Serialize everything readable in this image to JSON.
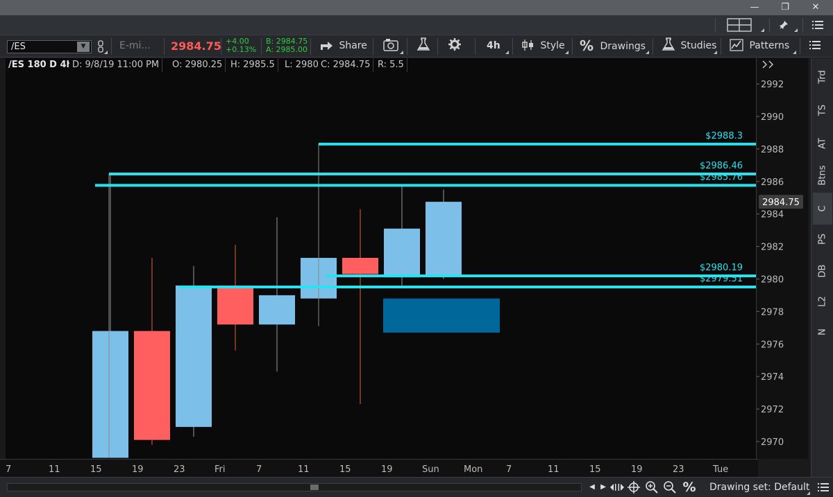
{
  "window": {
    "minimize_glyph": "—",
    "restore_glyph": "❐",
    "close_glyph": "✕"
  },
  "toolbar2": {
    "grid_layout_icon": "grid-layout-icon",
    "pin_icon": "pin-icon",
    "menu_icon": "menu-icon"
  },
  "toolbar": {
    "symbol": "/ES",
    "symbol_description": "E-mi...",
    "last_price": "2984.75",
    "net_change": "+4.00",
    "pct_change": "+0.13%",
    "bid": "B: 2984.75",
    "ask": "A: 2985.00",
    "share_label": "Share",
    "timeframe_label": "4h",
    "style_label": "Style",
    "drawings_label": "Drawings",
    "studies_label": "Studies",
    "patterns_label": "Patterns",
    "colors": {
      "last_price": "#ff5a5a",
      "change": "#2ecc40"
    }
  },
  "infobar": {
    "title": "/ES 180 D 4h",
    "date": "D: 9/8/19 11:00 PM",
    "open": "O: 2980.25",
    "high": "H: 2985.5",
    "low": "L: 2980",
    "close": "C: 2984.75",
    "range": "R: 5.5"
  },
  "chart_data": {
    "type": "candlestick",
    "ylim": [
      2969,
      2993.5
    ],
    "y_ticks": [
      2970,
      2972,
      2974,
      2976,
      2978,
      2980,
      2982,
      2984,
      2986,
      2988,
      2990,
      2992
    ],
    "x_tick_labels": [
      "7",
      "11",
      "15",
      "19",
      "23",
      "Fri",
      "7",
      "11",
      "15",
      "19",
      "Sun",
      "Mon",
      "7",
      "11",
      "15",
      "19",
      "23",
      "Tue"
    ],
    "candles": [
      {
        "open": 2969,
        "high": 2986.5,
        "low": 2969,
        "close": 2976.8
      },
      {
        "open": 2976.8,
        "high": 2981.3,
        "low": 2969.8,
        "close": 2970.1
      },
      {
        "open": 2970.9,
        "high": 2980.8,
        "low": 2970.3,
        "close": 2979.6
      },
      {
        "open": 2979.6,
        "high": 2982.1,
        "low": 2975.6,
        "close": 2977.2
      },
      {
        "open": 2977.2,
        "high": 2983.8,
        "low": 2974.3,
        "close": 2979.0
      },
      {
        "open": 2978.8,
        "high": 2988.3,
        "low": 2977.1,
        "close": 2981.3
      },
      {
        "open": 2981.3,
        "high": 2984.3,
        "low": 2972.3,
        "close": 2980.3
      },
      {
        "open": 2980.1,
        "high": 2985.8,
        "low": 2979.6,
        "close": 2983.1
      },
      {
        "open": 2980.25,
        "high": 2985.5,
        "low": 2980,
        "close": 2984.75
      }
    ],
    "price_lines": [
      {
        "label": "$2988.3",
        "value": 2988.3
      },
      {
        "label": "$2986.46",
        "value": 2986.46
      },
      {
        "label": "$2985.76",
        "value": 2985.76
      },
      {
        "label": "$2980.19",
        "value": 2980.19
      },
      {
        "label": "$2979.51",
        "value": 2979.51
      }
    ],
    "zone": {
      "from": 2976.7,
      "to": 2978.8
    },
    "last_price_label": "2984.75",
    "colors": {
      "up": "#7cbfe8",
      "down": "#ff5f5f",
      "line": "#27e3ef",
      "zone": "#00679b",
      "wick_up": "#9a9a9a",
      "wick_down": "#e0643a"
    }
  },
  "sidetabs": [
    "Trd",
    "TS",
    "AT",
    "Btns",
    "C",
    "PS",
    "DB",
    "L2",
    "N"
  ],
  "bottombar": {
    "drawing_set": "Drawing set: Default",
    "percent_glyph": "%"
  }
}
